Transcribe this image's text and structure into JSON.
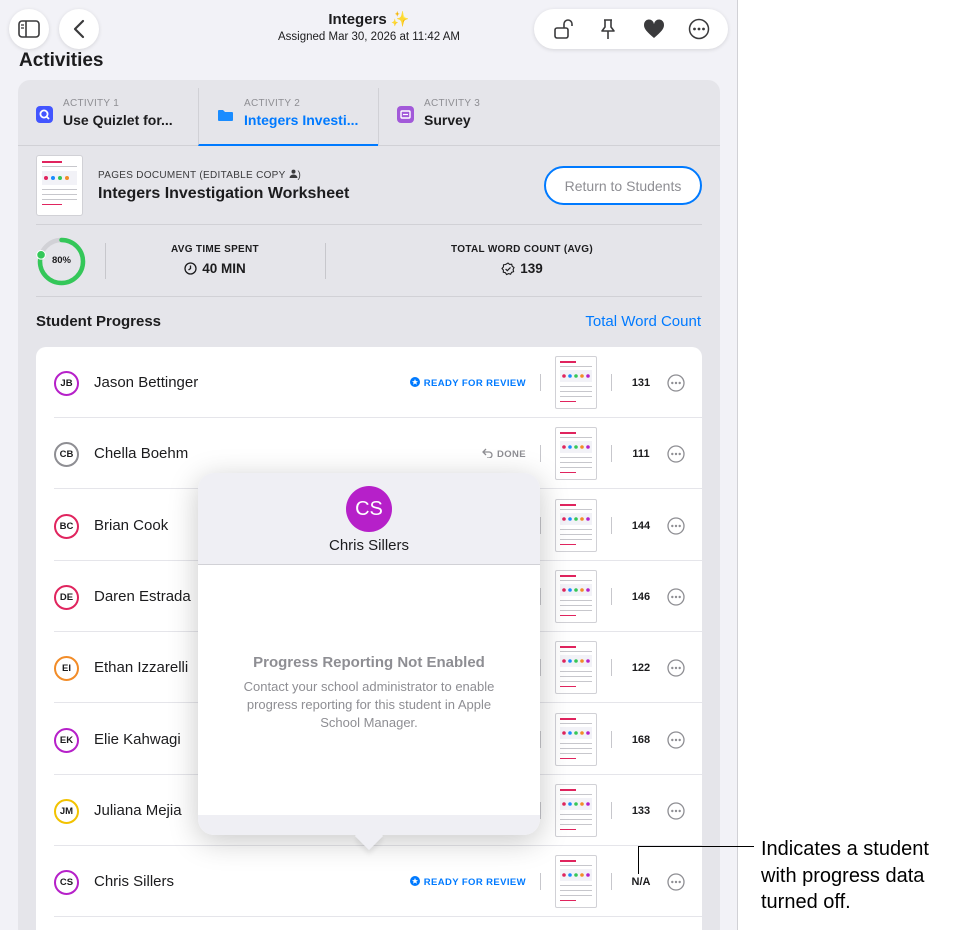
{
  "nav": {
    "title": "Integers ✨",
    "subtitle": "Assigned Mar 30, 2026 at 11:42 AM",
    "icons": [
      "sidebar-icon",
      "back-chevron-icon",
      "unlock-icon",
      "pin-icon",
      "heart-icon",
      "more-icon"
    ]
  },
  "section_title": "Activities",
  "tabs": [
    {
      "caption": "ACTIVITY 1",
      "label": "Use Quizlet for...",
      "icon": "quizlet-icon",
      "color": "#4255ff"
    },
    {
      "caption": "ACTIVITY 2",
      "label": "Integers Investi...",
      "icon": "folder-icon",
      "color": "#1a8cff",
      "selected": true
    },
    {
      "caption": "ACTIVITY 3",
      "label": "Survey",
      "icon": "survey-icon",
      "color": "#a259d9"
    }
  ],
  "document": {
    "type_label": "PAGES DOCUMENT (EDITABLE COPY",
    "type_suffix": ")",
    "title": "Integers Investigation Worksheet",
    "return_button": "Return to Students"
  },
  "stats": {
    "completion_label": "80%",
    "completion_fraction": 0.8,
    "avg_time_caption": "AVG TIME SPENT",
    "avg_time_value": "40 MIN",
    "word_count_caption": "TOTAL WORD COUNT (AVG)",
    "word_count_value": "139",
    "accent_green": "#34c759"
  },
  "student_progress": {
    "title": "Student Progress",
    "sort_link": "Total Word Count",
    "students": [
      {
        "initials": "JB",
        "name": "Jason Bettinger",
        "status": "READY FOR REVIEW",
        "status_kind": "review",
        "word_count": "131",
        "ring_color": "#b620c9"
      },
      {
        "initials": "CB",
        "name": "Chella Boehm",
        "status": "DONE",
        "status_kind": "done",
        "word_count": "111",
        "ring_color": "#8e8e93"
      },
      {
        "initials": "BC",
        "name": "Brian Cook",
        "status": "",
        "status_kind": "",
        "word_count": "144",
        "ring_color": "#e0245e"
      },
      {
        "initials": "DE",
        "name": "Daren Estrada",
        "status": "",
        "status_kind": "",
        "word_count": "146",
        "ring_color": "#e0245e"
      },
      {
        "initials": "EI",
        "name": "Ethan Izzarelli",
        "status": "",
        "status_kind": "",
        "word_count": "122",
        "ring_color": "#f28c28"
      },
      {
        "initials": "EK",
        "name": "Elie Kahwagi",
        "status": "",
        "status_kind": "",
        "word_count": "168",
        "ring_color": "#b620c9"
      },
      {
        "initials": "JM",
        "name": "Juliana Mejia",
        "status": "",
        "status_kind": "",
        "word_count": "133",
        "ring_color": "#f2c200"
      },
      {
        "initials": "CS",
        "name": "Chris Sillers",
        "status": "READY FOR REVIEW",
        "status_kind": "review",
        "word_count": "N/A",
        "ring_color": "#b620c9"
      }
    ]
  },
  "popover": {
    "initials": "CS",
    "name": "Chris Sillers",
    "message_title": "Progress Reporting Not Enabled",
    "message_body": "Contact your school administrator to enable progress reporting for this student in Apple School Manager.",
    "avatar_color": "#b620c9"
  },
  "callout": {
    "text": "Indicates a student with progress data turned off."
  }
}
